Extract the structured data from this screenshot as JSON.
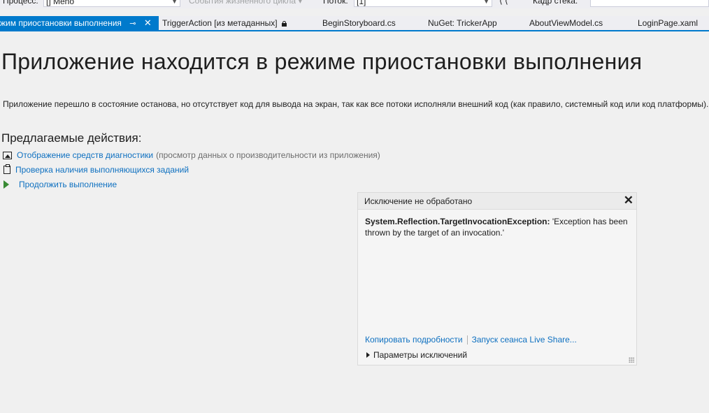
{
  "toolbar": {
    "process_label": "Процесс:",
    "process_value": "[] Meno",
    "lifecycle_label": "События жизненного цикла",
    "thread_label": "Поток:",
    "thread_value": "[1]",
    "stack_frame_label": "Кадр стека:"
  },
  "tabs": [
    {
      "label": "жим приостановки выполнения",
      "pin": "⊸",
      "close": "✕"
    },
    {
      "label": "TriggerAction [из метаданных]"
    },
    {
      "label": "BeginStoryboard.cs"
    },
    {
      "label": "NuGet: TrickerApp"
    },
    {
      "label": "AboutViewModel.cs"
    },
    {
      "label": "LoginPage.xaml"
    }
  ],
  "main": {
    "title": "Приложение находится в режиме приостановки выполнения",
    "description": "Приложение перешло в состояние останова, но отсутствует код для вывода на экран, так как все потоки исполняли внешний код (как правило, системный код или код платформы).",
    "actions_heading": "Предлагаемые действия:",
    "actions": [
      {
        "icon": "diagnostics-icon",
        "label": "Отображение средств диагностики",
        "note": "(просмотр данных о производительности из приложения)"
      },
      {
        "icon": "task-icon",
        "label": "Проверка наличия выполняющихся заданий",
        "note": ""
      },
      {
        "icon": "play-icon",
        "label": "Продолжить выполнение",
        "note": ""
      }
    ]
  },
  "exception": {
    "title": "Исключение не обработано",
    "close": "✕",
    "type": "System.Reflection.TargetInvocationException:",
    "message": " 'Exception has been thrown by the target of an invocation.'",
    "copy_details": "Копировать подробности",
    "live_share": "Запуск сеанса Live Share...",
    "settings": "Параметры исключений"
  },
  "colors": {
    "accent": "#007acc",
    "link": "#0e70c0",
    "play": "#388a34"
  }
}
